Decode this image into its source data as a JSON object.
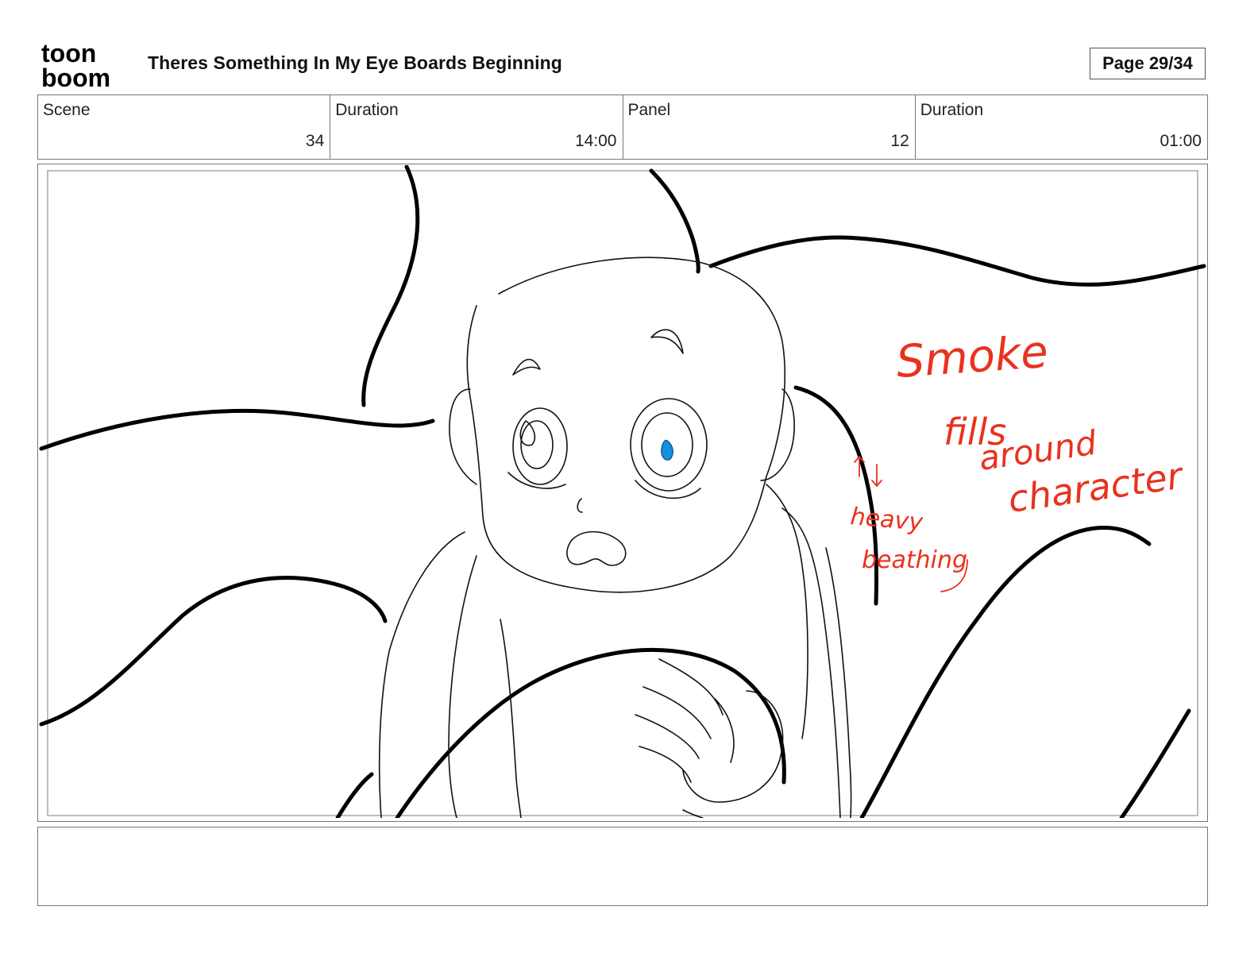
{
  "header": {
    "logo_line1": "toon",
    "logo_line2": "boom",
    "title": "Theres Something In My Eye Boards Beginning",
    "page": "Page 29/34"
  },
  "info": {
    "scene_label": "Scene",
    "scene_value": "34",
    "scene_duration_label": "Duration",
    "scene_duration_value": "14:00",
    "panel_label": "Panel",
    "panel_value": "12",
    "panel_duration_label": "Duration",
    "panel_duration_value": "01:00"
  },
  "panel": {
    "annotations": {
      "smoke": "Smoke",
      "fills": "fills",
      "around": "around",
      "character": "character",
      "heavy": "heavy",
      "breathing": "beathing"
    },
    "annotation_color": "#e8321e",
    "eye_color": "#1a8fe0"
  },
  "notes": {
    "text": ""
  }
}
